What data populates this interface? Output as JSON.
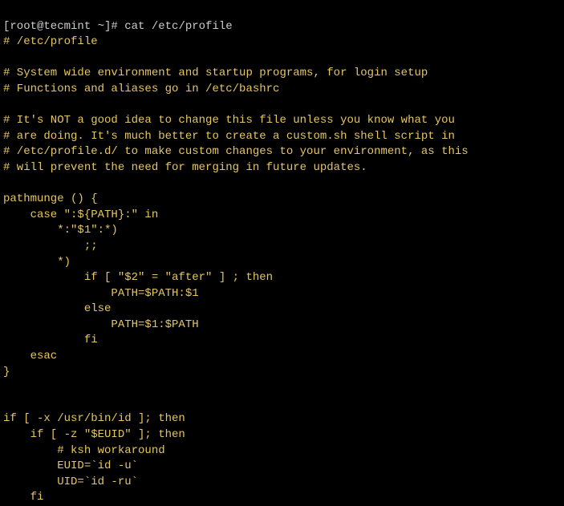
{
  "terminal": {
    "prompt": "[root@tecmint ~]# ",
    "command": "cat /etc/profile",
    "lines": [
      "# /etc/profile",
      "",
      "# System wide environment and startup programs, for login setup",
      "# Functions and aliases go in /etc/bashrc",
      "",
      "# It's NOT a good idea to change this file unless you know what you",
      "# are doing. It's much better to create a custom.sh shell script in",
      "# /etc/profile.d/ to make custom changes to your environment, as this",
      "# will prevent the need for merging in future updates.",
      "",
      "pathmunge () {",
      "    case \":${PATH}:\" in",
      "        *:\"$1\":*)",
      "            ;;",
      "        *)",
      "            if [ \"$2\" = \"after\" ] ; then",
      "                PATH=$PATH:$1",
      "            else",
      "                PATH=$1:$PATH",
      "            fi",
      "    esac",
      "}",
      "",
      "",
      "if [ -x /usr/bin/id ]; then",
      "    if [ -z \"$EUID\" ]; then",
      "        # ksh workaround",
      "        EUID=`id -u`",
      "        UID=`id -ru`",
      "    fi"
    ]
  }
}
